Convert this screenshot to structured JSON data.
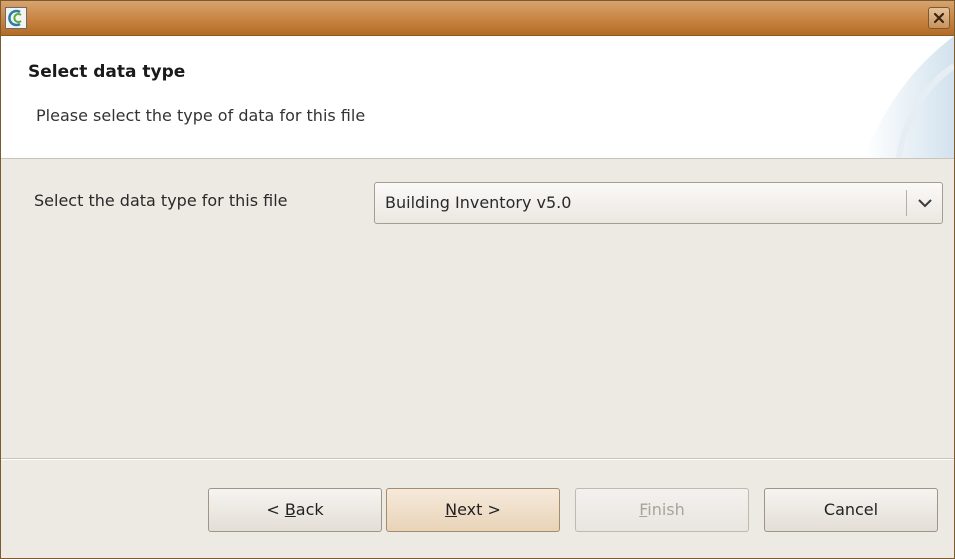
{
  "window": {
    "icon": "app-logo-icon",
    "close_icon": "close-icon"
  },
  "header": {
    "title": "Select data type",
    "description": "Please select the type of data for this file"
  },
  "form": {
    "label": "Select the data type for this file",
    "combo_value": "Building Inventory v5.0",
    "combo_icon": "chevron-down-icon"
  },
  "buttons": {
    "back": {
      "prefix": "< ",
      "mnemonic": "B",
      "rest": "ack"
    },
    "next": {
      "mnemonic": "N",
      "rest": "ext >"
    },
    "finish": {
      "mnemonic": "F",
      "rest": "inish"
    },
    "cancel": "Cancel"
  },
  "colors": {
    "titlebar": "#c78440",
    "header_bg": "#ffffff",
    "body_bg": "#ede9e3",
    "accent_swoosh": "#cfe0ee"
  }
}
